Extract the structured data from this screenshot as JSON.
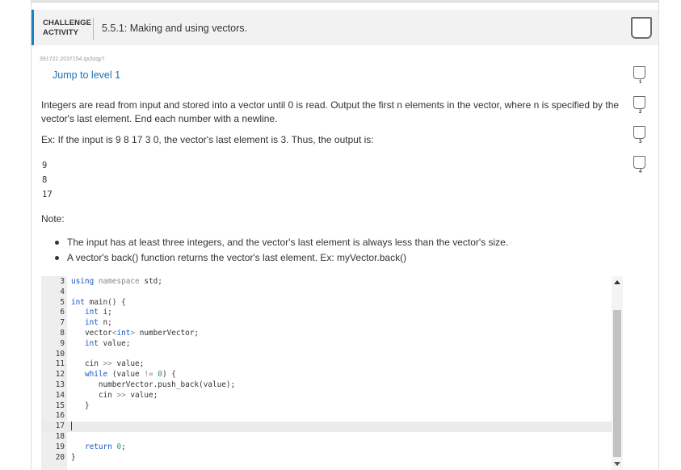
{
  "activity": {
    "label_line1": "CHALLENGE",
    "label_line2": "ACTIVITY",
    "title": "5.5.1: Making and using vectors."
  },
  "id_code": "391722.2037154.qx3zqy7",
  "jump_link": "Jump to level 1",
  "prompt": "Integers are read from input and stored into a vector until 0 is read. Output the first n elements in the vector, where n is specified by the vector's last element. End each number with a newline.",
  "example": "Ex: If the input is 9 8 17 3 0, the vector's last element is 3. Thus, the output is:",
  "output_lines": [
    "9",
    "8",
    "17"
  ],
  "note_label": "Note:",
  "notes": [
    "The input has at least three integers, and the vector's last element is always less than the vector's size.",
    "A vector's back() function returns the vector's last element. Ex: myVector.back()"
  ],
  "code": {
    "line_numbers": [
      "3",
      "4",
      "5",
      "6",
      "7",
      "8",
      "9",
      "10",
      "11",
      "12",
      "13",
      "14",
      "15",
      "16",
      "17",
      "18",
      "19",
      "20"
    ],
    "l3": [
      "using",
      " namespace",
      " std;"
    ],
    "l5": [
      "int",
      " main() {"
    ],
    "l6": [
      "int",
      " i;"
    ],
    "l7": [
      "int",
      " n;"
    ],
    "l8": [
      "vector",
      "<",
      "int",
      ">",
      " numberVector;"
    ],
    "l9": [
      "int",
      " value;"
    ],
    "l11": [
      "cin ",
      ">>",
      " value;"
    ],
    "l12": [
      "while",
      " (value ",
      "!=",
      " ",
      "0",
      ") {"
    ],
    "l13": [
      "numberVector.push_back(value);"
    ],
    "l14": [
      "cin ",
      ">>",
      " value;"
    ],
    "l15": [
      "}"
    ],
    "l19": [
      "return",
      " ",
      "0",
      ";"
    ],
    "l20": [
      "}"
    ]
  },
  "levels": [
    "1",
    "2",
    "3",
    "4"
  ],
  "colors": {
    "accent": "#1f7fc1",
    "link": "#1f6fb5",
    "keyword": "#1a56c5",
    "number": "#2a9d55"
  }
}
